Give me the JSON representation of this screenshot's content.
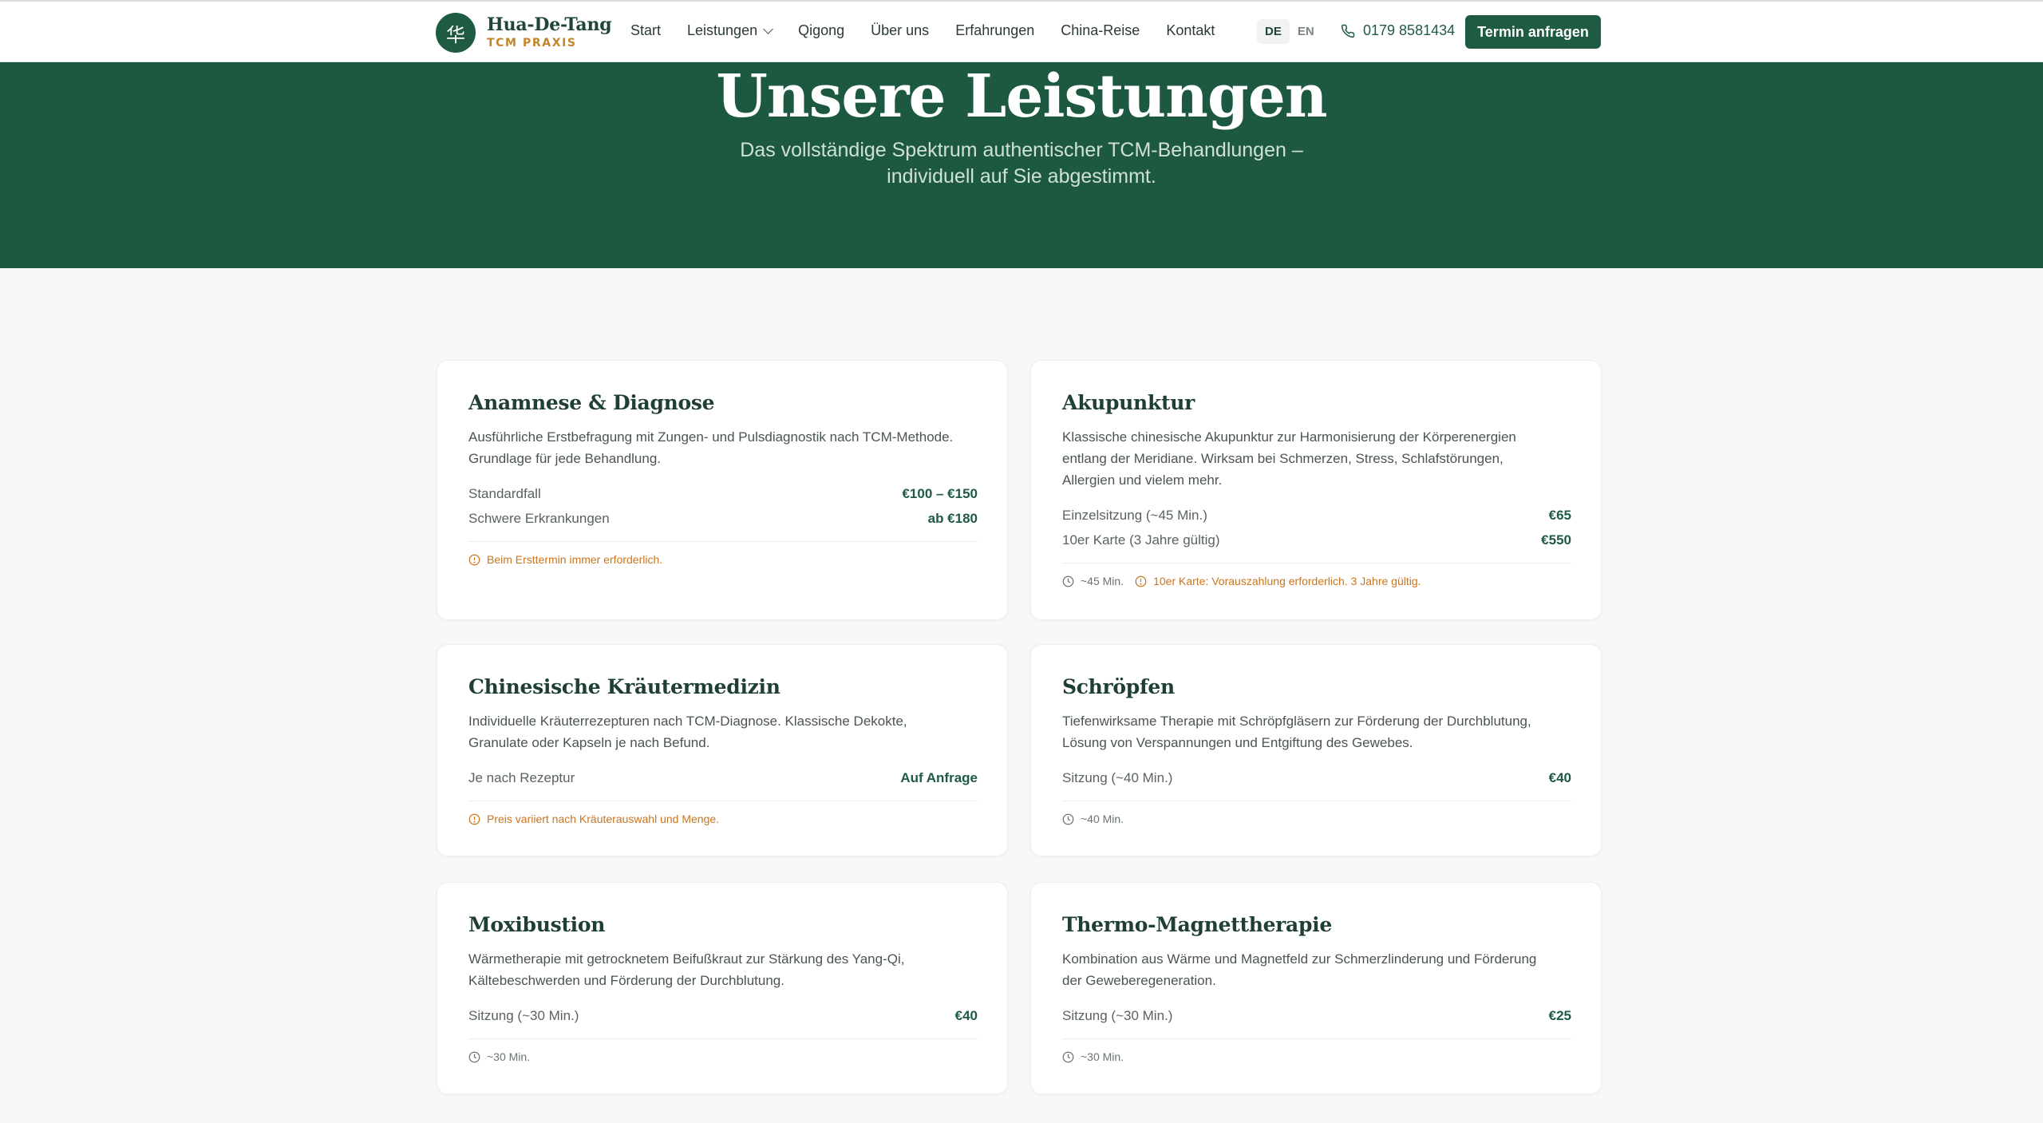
{
  "brand": {
    "mark": "华",
    "name": "Hua-De-Tang",
    "sub": "TCM PRAXIS"
  },
  "nav": {
    "links": [
      "Start",
      "Leistungen",
      "Qigong",
      "Über uns",
      "Erfahrungen",
      "China-Reise",
      "Kontakt"
    ],
    "lang": [
      "DE",
      "EN"
    ],
    "phone": "0179 8581434",
    "cta": "Termin anfragen"
  },
  "hero": {
    "title": "Unsere Leistungen",
    "subtitle": "Das vollständige Spektrum authentischer TCM-Behandlungen – individuell auf Sie abgestimmt."
  },
  "cards": [
    {
      "title": "Anamnese & Diagnose",
      "desc": "Ausführliche Erstbefragung mit Zungen- und Pulsdiagnostik nach TCM-Methode. Grundlage für jede Behandlung.",
      "prices": [
        {
          "label": "Standardfall",
          "value": "€100 – €150"
        },
        {
          "label": "Schwere Erkrankungen",
          "value": "ab €180"
        }
      ],
      "time": "",
      "warn": "Beim Ersttermin immer erforderlich."
    },
    {
      "title": "Akupunktur",
      "desc": "Klassische chinesische Akupunktur zur Harmonisierung der Körperenergien entlang der Meridiane. Wirksam bei Schmerzen, Stress, Schlafstörungen, Allergien und vielem mehr.",
      "prices": [
        {
          "label": "Einzelsitzung (~45 Min.)",
          "value": "€65"
        },
        {
          "label": "10er Karte (3 Jahre gültig)",
          "value": "€550"
        }
      ],
      "time": "~45 Min.",
      "warn": "10er Karte: Vorauszahlung erforderlich. 3 Jahre gültig."
    },
    {
      "title": "Chinesische Kräutermedizin",
      "desc": "Individuelle Kräuterrezepturen nach TCM-Diagnose. Klassische Dekokte, Granulate oder Kapseln je nach Befund.",
      "prices": [
        {
          "label": "Je nach Rezeptur",
          "value": "Auf Anfrage"
        }
      ],
      "time": "",
      "warn": "Preis variiert nach Kräuterauswahl und Menge."
    },
    {
      "title": "Schröpfen",
      "desc": "Tiefenwirksame Therapie mit Schröpfgläsern zur Förderung der Durchblutung, Lösung von Verspannungen und Entgiftung des Gewebes.",
      "prices": [
        {
          "label": "Sitzung (~40 Min.)",
          "value": "€40"
        }
      ],
      "time": "~40 Min.",
      "warn": ""
    },
    {
      "title": "Moxibustion",
      "desc": "Wärmetherapie mit getrocknetem Beifußkraut zur Stärkung des Yang-Qi, Kältebeschwerden und Förderung der Durchblutung.",
      "prices": [
        {
          "label": "Sitzung (~30 Min.)",
          "value": "€40"
        }
      ],
      "time": "~30 Min.",
      "warn": ""
    },
    {
      "title": "Thermo-Magnettherapie",
      "desc": "Kombination aus Wärme und Magnetfeld zur Schmerzlinderung und Förderung der Geweberegeneration.",
      "prices": [
        {
          "label": "Sitzung (~30 Min.)",
          "value": "€25"
        }
      ],
      "time": "~30 Min.",
      "warn": ""
    }
  ]
}
